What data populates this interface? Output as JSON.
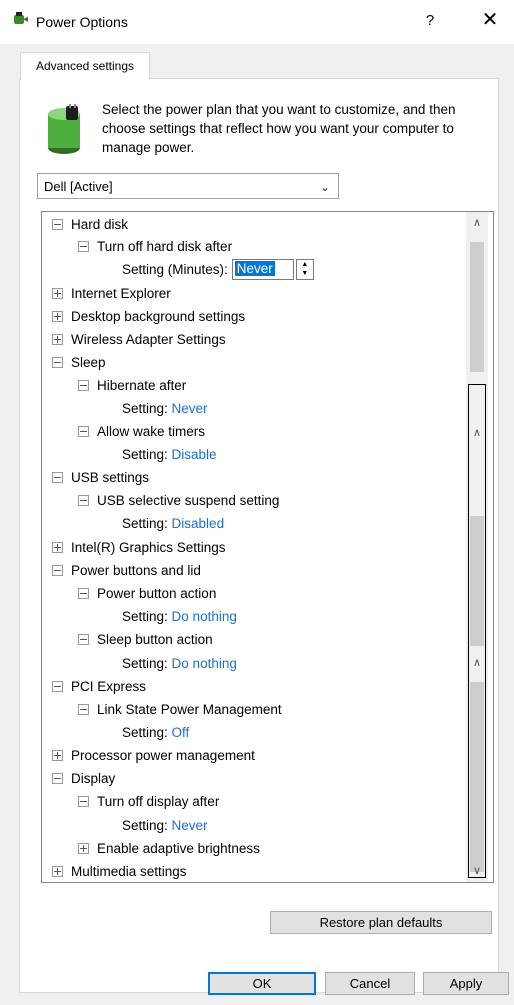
{
  "window": {
    "title": "Power Options",
    "help": "?",
    "close": "✕"
  },
  "tab": {
    "label": "Advanced settings"
  },
  "description": "Select the power plan that you want to customize, and then choose settings that reflect how you want your computer to manage power.",
  "plan": {
    "selected": "Dell [Active]"
  },
  "tree": {
    "nodes": [
      {
        "label": "Hard disk"
      },
      {
        "label": "Turn off hard disk after"
      },
      {
        "label": "Setting (Minutes):",
        "value": "Never"
      },
      {
        "label": "Internet Explorer"
      },
      {
        "label": "Desktop background settings"
      },
      {
        "label": "Wireless Adapter Settings"
      },
      {
        "label": "Sleep"
      },
      {
        "label": "Hibernate after"
      },
      {
        "label": "Setting:",
        "value": "Never"
      },
      {
        "label": "Allow wake timers"
      },
      {
        "label": "Setting:",
        "value": "Disable"
      },
      {
        "label": "USB settings"
      },
      {
        "label": "USB selective suspend setting"
      },
      {
        "label": "Setting:",
        "value": "Disabled"
      },
      {
        "label": "Intel(R) Graphics Settings"
      },
      {
        "label": "Power buttons and lid"
      },
      {
        "label": "Power button action"
      },
      {
        "label": "Setting:",
        "value": "Do nothing"
      },
      {
        "label": "Sleep button action"
      },
      {
        "label": "Setting:",
        "value": "Do nothing"
      },
      {
        "label": "PCI Express"
      },
      {
        "label": "Link State Power Management"
      },
      {
        "label": "Setting:",
        "value": "Off"
      },
      {
        "label": "Processor power management"
      },
      {
        "label": "Display"
      },
      {
        "label": "Turn off display after"
      },
      {
        "label": "Setting:",
        "value": "Never"
      },
      {
        "label": "Enable adaptive brightness"
      },
      {
        "label": "Multimedia settings"
      }
    ]
  },
  "buttons": {
    "restore": "Restore plan defaults",
    "ok": "OK",
    "cancel": "Cancel",
    "apply": "Apply"
  },
  "colors": {
    "value_link": "#1a6ed8",
    "selection": "#0078d7"
  }
}
